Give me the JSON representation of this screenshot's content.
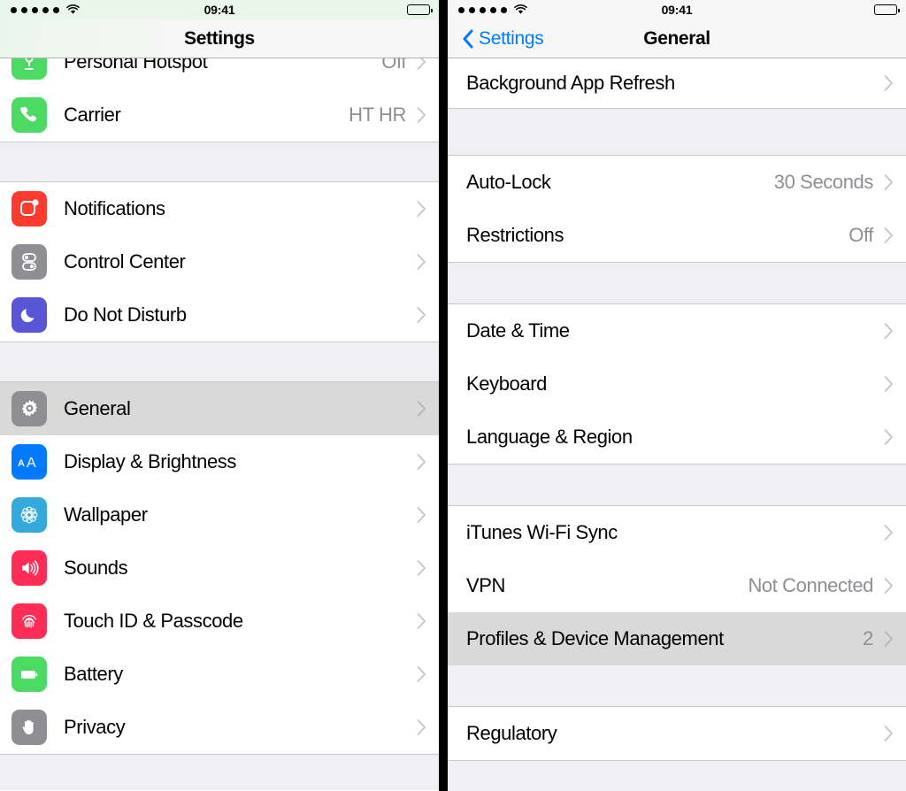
{
  "status_bar": {
    "signal_dots": 5,
    "wifi_icon": "wifi-icon",
    "time": "09:41",
    "battery_icon": "battery-full-icon",
    "battery_level": 100
  },
  "left_panel": {
    "nav": {
      "title": "Settings"
    },
    "sections": [
      {
        "rows": [
          {
            "label": "Personal Hotspot",
            "value": "Off",
            "icon": "personal-hotspot-icon",
            "icon_color": "#4CD964",
            "clipped": true,
            "pressed": false
          },
          {
            "label": "Carrier",
            "value": "HT HR",
            "icon": "carrier-phone-icon",
            "icon_color": "#4CD964",
            "clipped": false,
            "pressed": false
          }
        ]
      },
      {
        "rows": [
          {
            "label": "Notifications",
            "value": "",
            "icon": "notifications-icon",
            "icon_color": "#FF3B30",
            "clipped": false,
            "pressed": false
          },
          {
            "label": "Control Center",
            "value": "",
            "icon": "control-center-icon",
            "icon_color": "#8E8E93",
            "clipped": false,
            "pressed": false
          },
          {
            "label": "Do Not Disturb",
            "value": "",
            "icon": "do-not-disturb-moon-icon",
            "icon_color": "#5856D6",
            "clipped": false,
            "pressed": false
          }
        ]
      },
      {
        "rows": [
          {
            "label": "General",
            "value": "",
            "icon": "general-gear-icon",
            "icon_color": "#8E8E93",
            "clipped": false,
            "pressed": true
          },
          {
            "label": "Display & Brightness",
            "value": "",
            "icon": "display-brightness-aa-icon",
            "icon_color": "#007AFF",
            "clipped": false,
            "pressed": false
          },
          {
            "label": "Wallpaper",
            "value": "",
            "icon": "wallpaper-flower-icon",
            "icon_color": "#34AADC",
            "clipped": false,
            "pressed": false
          },
          {
            "label": "Sounds",
            "value": "",
            "icon": "sounds-speaker-icon",
            "icon_color": "#FF2D55",
            "clipped": false,
            "pressed": false
          },
          {
            "label": "Touch ID & Passcode",
            "value": "",
            "icon": "touch-id-fingerprint-icon",
            "icon_color": "#FF2D55",
            "clipped": false,
            "pressed": false
          },
          {
            "label": "Battery",
            "value": "",
            "icon": "battery-icon",
            "icon_color": "#4CD964",
            "clipped": false,
            "pressed": false
          },
          {
            "label": "Privacy",
            "value": "",
            "icon": "privacy-hand-icon",
            "icon_color": "#8E8E93",
            "clipped": false,
            "pressed": false
          }
        ]
      }
    ]
  },
  "right_panel": {
    "nav": {
      "back_label": "Settings",
      "back_icon": "chevron-left-icon",
      "title": "General"
    },
    "sections": [
      {
        "rows": [
          {
            "label": "Background App Refresh",
            "value": "",
            "pressed": false
          }
        ]
      },
      {
        "rows": [
          {
            "label": "Auto-Lock",
            "value": "30 Seconds",
            "pressed": false
          },
          {
            "label": "Restrictions",
            "value": "Off",
            "pressed": false
          }
        ]
      },
      {
        "rows": [
          {
            "label": "Date & Time",
            "value": "",
            "pressed": false
          },
          {
            "label": "Keyboard",
            "value": "",
            "pressed": false
          },
          {
            "label": "Language & Region",
            "value": "",
            "pressed": false
          }
        ]
      },
      {
        "rows": [
          {
            "label": "iTunes Wi-Fi Sync",
            "value": "",
            "pressed": false
          },
          {
            "label": "VPN",
            "value": "Not Connected",
            "pressed": false
          },
          {
            "label": "Profiles & Device Management",
            "value": "2",
            "pressed": true
          }
        ]
      },
      {
        "rows": [
          {
            "label": "Regulatory",
            "value": "",
            "pressed": false
          }
        ]
      }
    ]
  },
  "colors": {
    "accent_blue": "#007AFF",
    "group_background": "#EFEFF4",
    "separator": "#C8C7CC",
    "value_gray": "#8E8E93",
    "pressed_row": "#D9D9D9"
  }
}
